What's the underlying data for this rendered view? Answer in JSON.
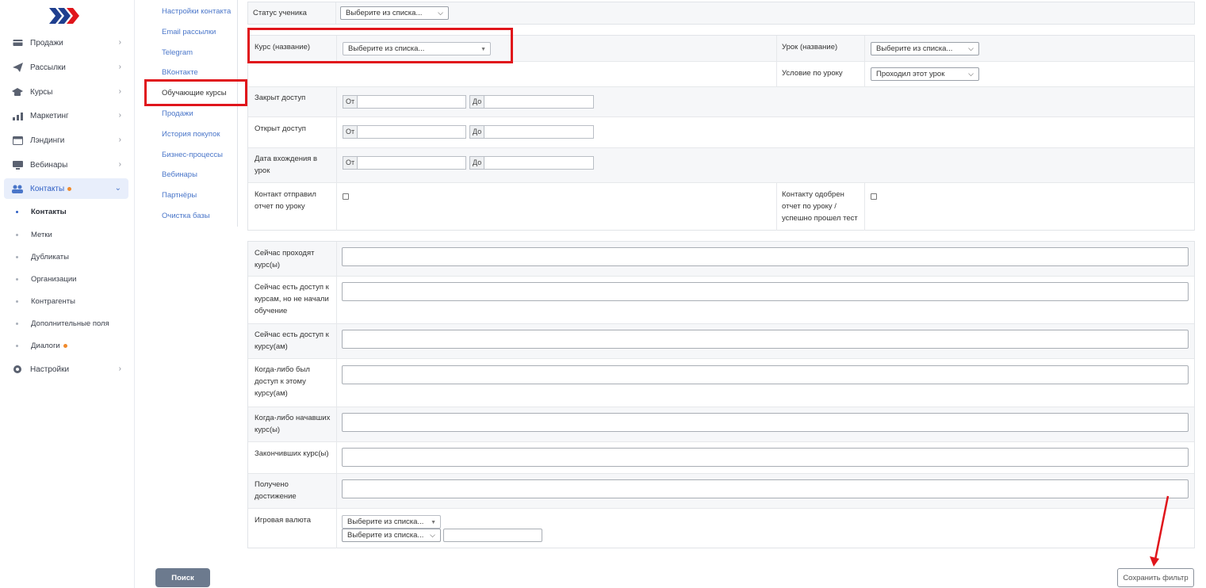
{
  "sidebar": {
    "items": [
      {
        "label": "Продажи",
        "icon": "wallet-icon"
      },
      {
        "label": "Рассылки",
        "icon": "paper-plane-icon"
      },
      {
        "label": "Курсы",
        "icon": "graduation-cap-icon"
      },
      {
        "label": "Маркетинг",
        "icon": "bar-chart-icon"
      },
      {
        "label": "Лэндинги",
        "icon": "browser-window-icon"
      },
      {
        "label": "Вебинары",
        "icon": "monitor-icon"
      },
      {
        "label": "Контакты",
        "icon": "users-icon"
      },
      {
        "label": "Настройки",
        "icon": "gear-icon"
      }
    ],
    "sub_items": [
      "Контакты",
      "Метки",
      "Дубликаты",
      "Организации",
      "Контрагенты",
      "Дополнительные поля",
      "Диалоги"
    ]
  },
  "menu2": {
    "items": [
      "Настройки контакта",
      "Email рассылки",
      "Telegram",
      "ВКонтакте",
      "Обучающие курсы",
      "Продажи",
      "История покупок",
      "Бизнес-процессы",
      "Вебинары",
      "Партнёры",
      "Очистка базы"
    ]
  },
  "filters": {
    "student_status": {
      "label": "Статус ученика",
      "value": "Выберите из списка..."
    },
    "course": {
      "label": "Курс (название)",
      "value": "Выберите из списка..."
    },
    "lesson": {
      "label": "Урок (название)",
      "value": "Выберите из списка..."
    },
    "lesson_condition": {
      "label": "Условие по уроку",
      "value": "Проходил этот урок"
    },
    "closed_access": {
      "label": "Закрыт доступ"
    },
    "opened_access": {
      "label": "Открыт доступ"
    },
    "entry_date": {
      "label": "Дата вхождения в урок"
    },
    "date_from": "От",
    "date_to": "До",
    "sent_report": {
      "label": "Контакт отправил отчет по уроку"
    },
    "approved_report": {
      "label": "Контакту одобрен отчет по уроку / успешно прошел тест"
    }
  },
  "course_filters": [
    "Сейчас проходят курс(ы)",
    "Сейчас есть доступ к курсам, но не начали обучение",
    "Сейчас есть доступ к курсу(ам)",
    "Когда-либо был доступ к этому курсу(ам)",
    "Когда-либо начавших курс(ы)",
    "Закончивших курс(ы)",
    "Получено достижение"
  ],
  "game_currency": {
    "label": "Игровая валюта",
    "select1": "Выберите из списка...",
    "select2": "Выберите из списка..."
  },
  "buttons": {
    "search": "Поиск",
    "save_filter": "Сохранить фильтр"
  },
  "colors": {
    "highlight": "#e0151b",
    "link": "#4a76c9",
    "active_bg": "#e8eefb",
    "accent_dot": "#f08a2c",
    "search_button": "#6c7a8e"
  }
}
